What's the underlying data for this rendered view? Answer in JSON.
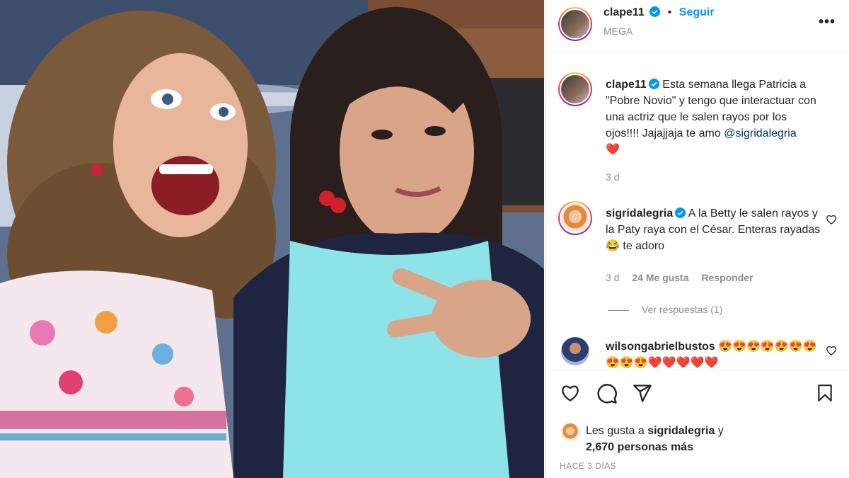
{
  "post": {
    "author": {
      "username": "clape11",
      "verified": true,
      "location": "MEGA",
      "follow_label": "Seguir",
      "more_icon": "more-icon"
    },
    "caption": {
      "username": "clape11",
      "text": "Esta semana llega Patricia a \"Pobre Novio\" y tengo que interactuar con una actriz que le salen rayos por los ojos!!!! Jajajjaja te amo",
      "mention": "@sigridalegria",
      "emoji": "❤️",
      "age": "3 d"
    },
    "comments": [
      {
        "username": "sigridalegria",
        "verified": true,
        "text": "A la Betty le salen rayos y la Paty raya con el César. Enteras rayadas 😂 te adoro",
        "age": "3 d",
        "likes": "24 Me gusta",
        "reply_label": "Responder",
        "view_replies": "Ver respuestas (1)"
      },
      {
        "username": "wilsongabrielbustos",
        "verified": false,
        "text": "😍😍😍😍😍😍😍😍😍😍❤️❤️❤️❤️❤️"
      }
    ],
    "likes_summary": {
      "prefix": "Les gusta a",
      "user": "sigridalegria",
      "conj": "y",
      "count": "2,670 personas más"
    },
    "time_ago": "HACE 3 DÍAS",
    "colors": {
      "link": "#0095f6",
      "text": "#262626",
      "muted": "#8e8e8e",
      "heart": "#ed4956",
      "verified": "#0095f6"
    }
  }
}
